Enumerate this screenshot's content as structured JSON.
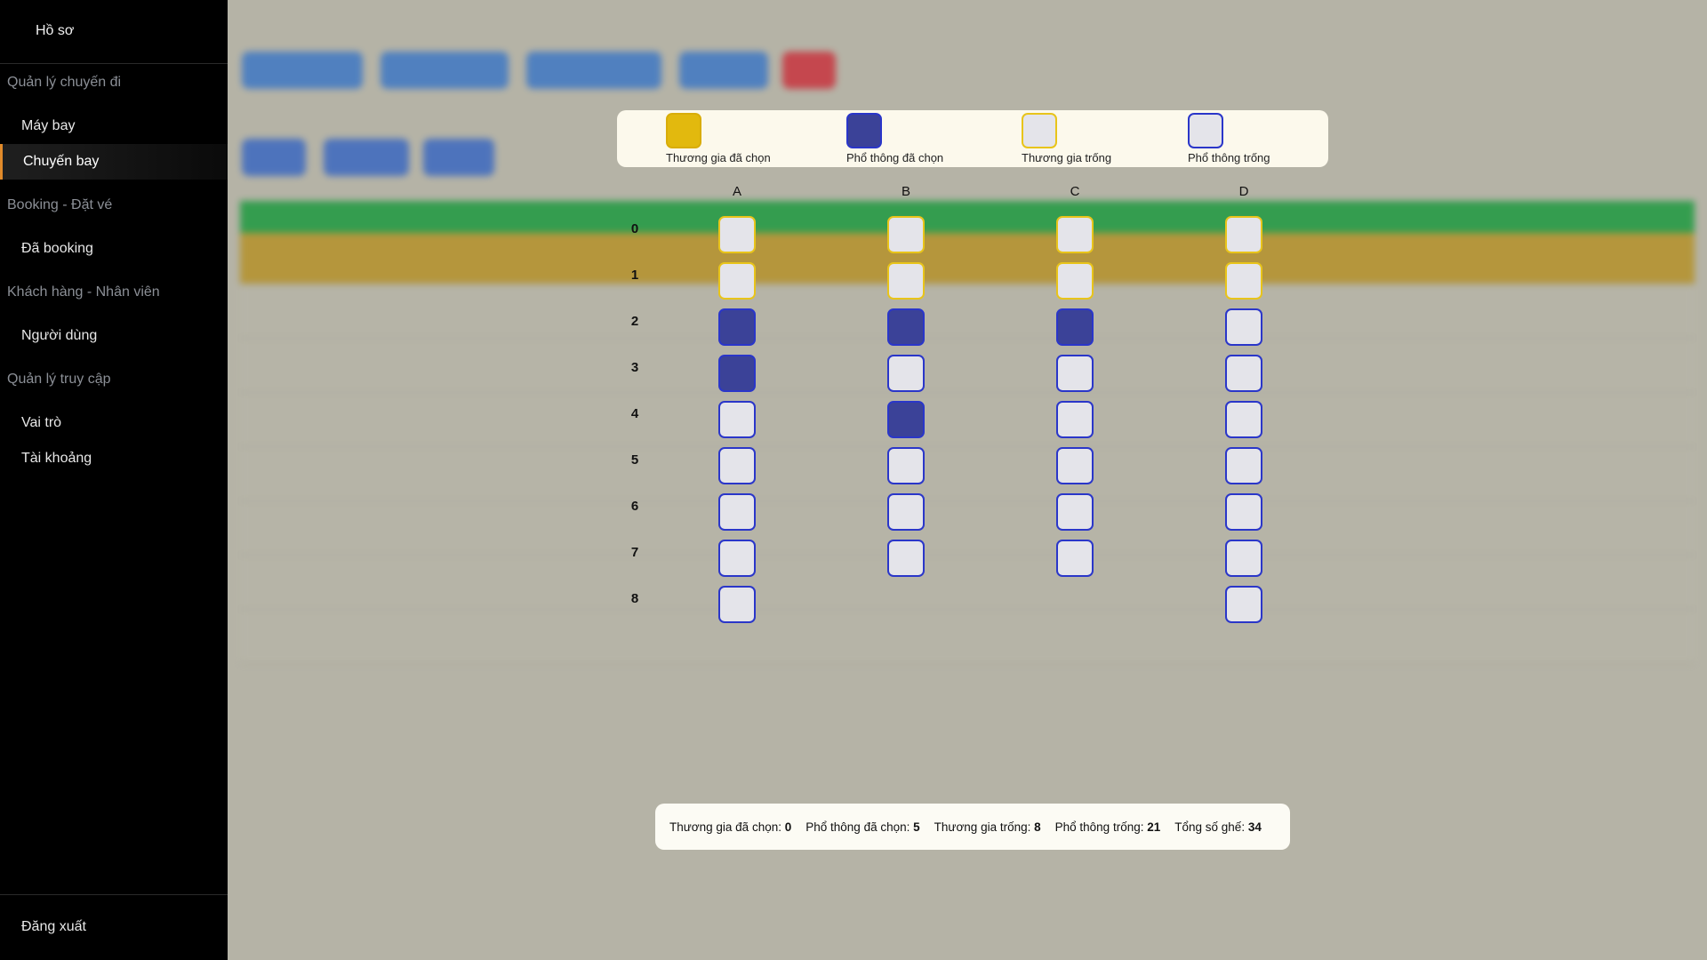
{
  "sidebar": {
    "profile": "Hồ sơ",
    "groups": [
      {
        "title": "Quản lý chuyến đi",
        "items": [
          "Máy bay",
          "Chuyến bay"
        ]
      },
      {
        "title": "Booking - Đặt vé",
        "items": [
          "Đã booking"
        ]
      },
      {
        "title": "Khách hàng - Nhân viên",
        "items": [
          "Người dùng"
        ]
      },
      {
        "title": "Quản lý truy cập",
        "items": [
          "Vai trò",
          "Tài khoảng"
        ]
      }
    ],
    "active_item": "Chuyến bay",
    "logout": "Đăng xuất",
    "accent_color": "#e08a2a"
  },
  "legend": {
    "business_selected": "Thương gia đã chọn",
    "economy_selected": "Phổ thông đã chọn",
    "business_free": "Thương gia trống",
    "economy_free": "Phổ thông trống"
  },
  "colors": {
    "business_selected": "#e2b90e",
    "economy_selected": "#3b4298",
    "business_border": "#e8c41a",
    "economy_border": "#2a36c9",
    "seat_fill": "#e4e4ea"
  },
  "seat_map": {
    "columns": [
      "A",
      "B",
      "C",
      "D"
    ],
    "rows": [
      "0",
      "1",
      "2",
      "3",
      "4",
      "5",
      "6",
      "7",
      "8"
    ],
    "seats": [
      [
        "biz-free",
        "biz-free",
        "biz-free",
        "biz-free"
      ],
      [
        "biz-free",
        "biz-free",
        "biz-free",
        "biz-free"
      ],
      [
        "eco-sel",
        "eco-sel",
        "eco-sel",
        "eco-free"
      ],
      [
        "eco-sel",
        "eco-free",
        "eco-free",
        "eco-free"
      ],
      [
        "eco-free",
        "eco-sel",
        "eco-free",
        "eco-free"
      ],
      [
        "eco-free",
        "eco-free",
        "eco-free",
        "eco-free"
      ],
      [
        "eco-free",
        "eco-free",
        "eco-free",
        "eco-free"
      ],
      [
        "eco-free",
        "eco-free",
        "eco-free",
        "eco-free"
      ],
      [
        "eco-free",
        null,
        null,
        "eco-free"
      ]
    ]
  },
  "summary": {
    "business_selected_label": "Thương gia đã chọn:",
    "business_selected": "0",
    "economy_selected_label": "Phổ thông đã chọn:",
    "economy_selected": "5",
    "business_free_label": "Thương gia trống:",
    "business_free": "8",
    "economy_free_label": "Phổ thông trống:",
    "economy_free": "21",
    "total_label": "Tổng số ghế:",
    "total": "34"
  }
}
